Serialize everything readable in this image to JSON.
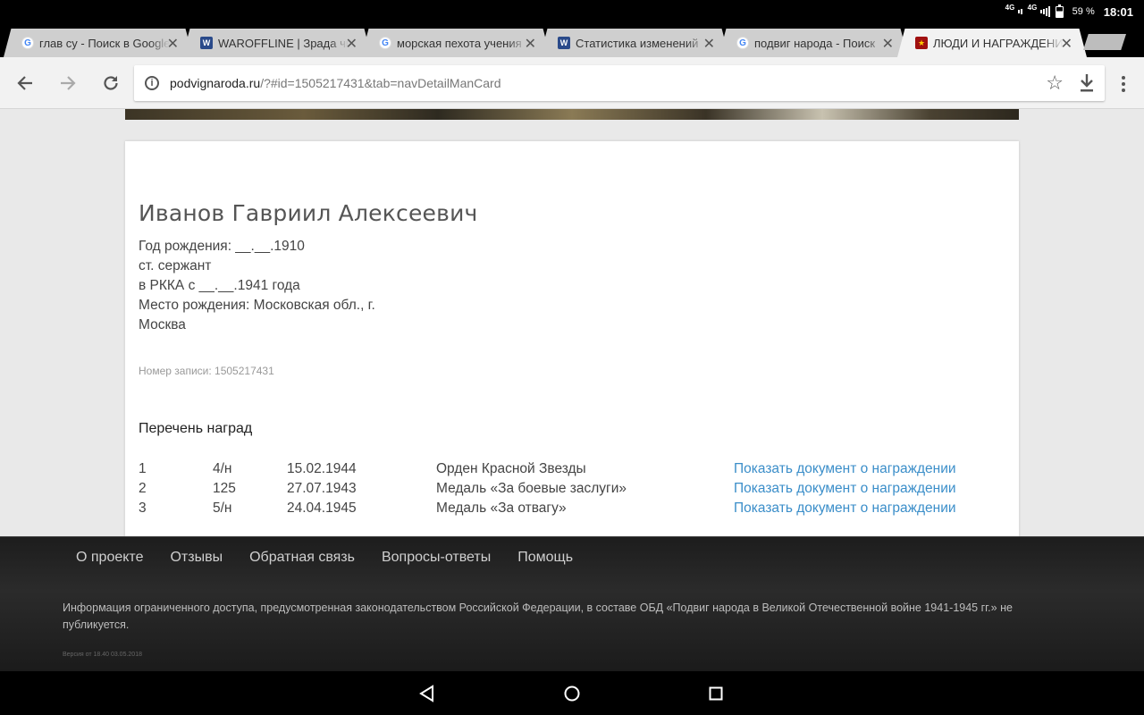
{
  "status_bar": {
    "network_1": "4G",
    "network_2": "4G",
    "battery": "59 %",
    "time": "18:01"
  },
  "tabs": [
    {
      "title": "глав су - Поиск в Google",
      "icon": "google-icon",
      "active": false
    },
    {
      "title": "WAROFFLINE | Зрада чи",
      "icon": "waroffline-icon",
      "active": false
    },
    {
      "title": "морская пехота учения",
      "icon": "google-icon",
      "active": false
    },
    {
      "title": "Статистика изменений",
      "icon": "waroffline-icon",
      "active": false
    },
    {
      "title": "подвиг народа - Поиск",
      "icon": "google-icon",
      "active": false
    },
    {
      "title": "ЛЮДИ И НАГРАЖДЕНИ",
      "icon": "podvig-icon",
      "active": true
    }
  ],
  "address_bar": {
    "host": "podvignaroda.ru",
    "path": "/?#id=1505217431&tab=navDetailManCard"
  },
  "person": {
    "name": "Иванов Гавриил Алексеевич",
    "birth_year": "Год рождения: __.__.1910",
    "rank": "ст. сержант",
    "service": "в РККА с __.__.1941 года",
    "birthplace_line1": "Место рождения: Московская обл., г.",
    "birthplace_line2": "Москва",
    "record_number": "Номер записи: 1505217431"
  },
  "awards": {
    "title": "Перечень наград",
    "rows": [
      {
        "num": "1",
        "doc": "4/н",
        "date": "15.02.1944",
        "name": "Орден Красной Звезды",
        "link": "Показать документ о награждении"
      },
      {
        "num": "2",
        "doc": "125",
        "date": "27.07.1943",
        "name": "Медаль «За боевые заслуги»",
        "link": "Показать документ о награждении"
      },
      {
        "num": "3",
        "doc": "5/н",
        "date": "24.04.1945",
        "name": "Медаль «За отвагу»",
        "link": "Показать документ о награждении"
      }
    ]
  },
  "footer": {
    "nav": [
      "О проекте",
      "Отзывы",
      "Обратная связь",
      "Вопросы-ответы",
      "Помощь"
    ],
    "note": "Информация ограниченного доступа, предусмотренная законодательством Российской Федерации, в составе ОБД «Подвиг народа в Великой Отечественной войне 1941-1945 гг.» не публикуется.",
    "version": "Версия от 18.40 03.05.2018"
  },
  "colors": {
    "link": "#3b8ec9",
    "footer_bg": "#232323",
    "page_bg": "#e9e9e9"
  }
}
